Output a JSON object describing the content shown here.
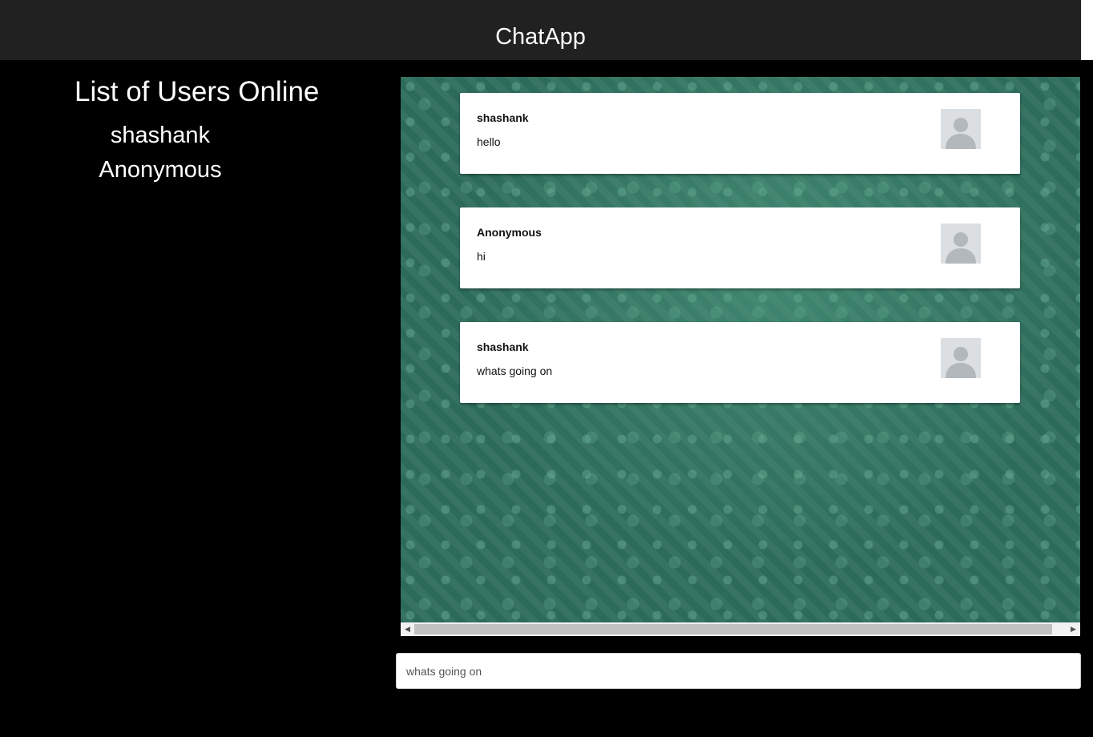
{
  "header": {
    "title": "ChatApp"
  },
  "sidebar": {
    "title": "List of Users Online",
    "users": [
      "shashank",
      "Anonymous"
    ]
  },
  "messages": [
    {
      "author": "shashank",
      "text": "hello",
      "avatar": "user-placeholder-icon"
    },
    {
      "author": "Anonymous",
      "text": "hi",
      "avatar": "user-placeholder-icon"
    },
    {
      "author": "shashank",
      "text": "whats going on",
      "avatar": "user-placeholder-icon"
    }
  ],
  "composer": {
    "placeholder": "whats going on",
    "value": ""
  },
  "colors": {
    "header_bg": "#212121",
    "page_bg": "#000000",
    "chat_bg": "#2c6b5a",
    "card_bg": "#ffffff",
    "avatar_bg": "#dcdfe2"
  }
}
